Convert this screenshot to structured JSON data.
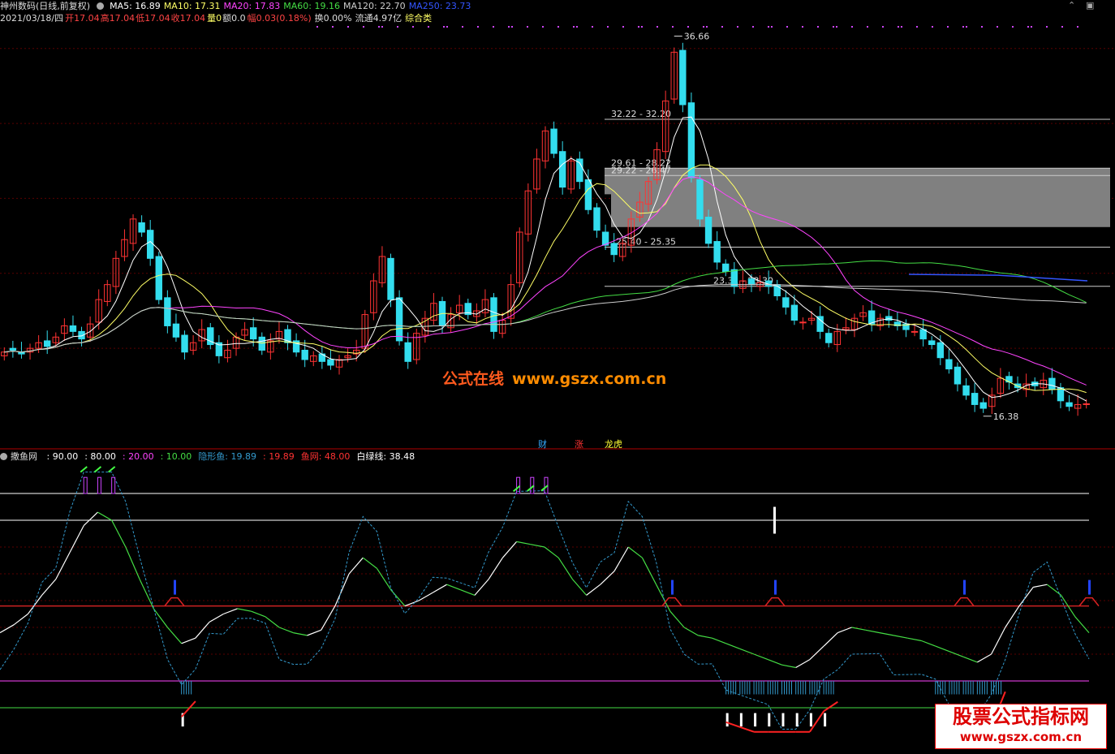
{
  "header": {
    "stock_name": "神州数码(日线,前复权)",
    "ma": [
      {
        "label": "MA5:",
        "value": "16.89",
        "color": "#ffffff"
      },
      {
        "label": "MA10:",
        "value": "17.31",
        "color": "#ffff66"
      },
      {
        "label": "MA20:",
        "value": "17.83",
        "color": "#ff44ff"
      },
      {
        "label": "MA60:",
        "value": "19.16",
        "color": "#44dd44"
      },
      {
        "label": "MA120:",
        "value": "22.70",
        "color": "#cccccc"
      },
      {
        "label": "MA250:",
        "value": "23.73",
        "color": "#3355ff"
      }
    ],
    "date": "2021/03/18/四",
    "open": "开17.04",
    "high": "高17.04",
    "low": "低17.04",
    "close": "收17.04",
    "volume": "量0",
    "amount": "额0.0",
    "range": "幅0.03(0.18%)",
    "turnover": "换0.00%",
    "float_cap": "流通4.97亿",
    "category": "综合类"
  },
  "indicator_header": {
    "name": "撒鱼网",
    "items": [
      {
        "text": ": 90.00",
        "color": "#ffffff"
      },
      {
        "text": ": 80.00",
        "color": "#ffffff"
      },
      {
        "text": ": 20.00",
        "color": "#ff44ff"
      },
      {
        "text": ": 10.00",
        "color": "#44dd44"
      },
      {
        "text": "隐形鱼: 19.89",
        "color": "#3399cc"
      },
      {
        "text": ": 19.89",
        "color": "#ff3333"
      },
      {
        "text": "鱼网: 48.00",
        "color": "#ff3333"
      },
      {
        "text": "白绿线: 38.48",
        "color": "#ffffff"
      }
    ]
  },
  "watermark": {
    "cn": "公式在线",
    "url": "www.gszx.com.cn",
    "logo_title": "股票公式指标网",
    "logo_url": "www.gszx.com.cn"
  },
  "badges": [
    {
      "text": "财",
      "color": "#33aaff"
    },
    {
      "text": "涨",
      "color": "#ff3333"
    },
    {
      "text": "龙虎",
      "color": "#ffff33"
    }
  ],
  "corner_icons": [
    "up-chevron-icon",
    "window-restore-icon"
  ],
  "chart_data": [
    {
      "type": "candlestick",
      "panel": "price",
      "annotations": [
        "36.66",
        "16.38"
      ],
      "high_value": 36.66,
      "low_value": 16.38,
      "price_bands": [
        {
          "label": "32.22 - 32.20",
          "low": 32.2,
          "high": 32.22
        },
        {
          "label": "29.61 - 28.22",
          "low": 28.22,
          "high": 29.61,
          "shaded": true
        },
        {
          "label": "29.22 - 26.47",
          "low": 26.47,
          "high": 29.22,
          "shaded": true
        },
        {
          "label": "25.40 - 25.35",
          "low": 25.35,
          "high": 25.4
        },
        {
          "label": "23.31 - 23.30",
          "low": 23.3,
          "high": 23.31
        }
      ],
      "ylim": [
        15.2,
        37.2
      ],
      "series_colors": {
        "up": "#ff3333",
        "down": "#33ddee"
      },
      "close": [
        19.8,
        19.9,
        19.7,
        20.0,
        20.3,
        20.1,
        20.6,
        21.2,
        20.9,
        20.5,
        21.3,
        22.6,
        23.4,
        24.8,
        25.8,
        26.9,
        26.2,
        24.8,
        22.6,
        21.2,
        20.6,
        19.8,
        20.3,
        21.0,
        20.2,
        19.6,
        19.9,
        20.6,
        21.0,
        20.5,
        19.9,
        20.4,
        20.9,
        20.3,
        19.8,
        19.4,
        19.6,
        19.3,
        19.1,
        19.4,
        19.6,
        19.9,
        21.8,
        23.6,
        24.9,
        22.6,
        20.4,
        19.3,
        20.8,
        21.6,
        22.4,
        21.2,
        21.8,
        22.3,
        21.8,
        22.0,
        22.6,
        20.9,
        21.5,
        23.4,
        26.2,
        28.4,
        30.1,
        31.6,
        30.4,
        28.6,
        30.0,
        28.9,
        27.4,
        26.3,
        25.5,
        25.0,
        25.6,
        26.9,
        27.8,
        28.9,
        30.6,
        33.2,
        35.8,
        33.0,
        29.1,
        26.9,
        25.6,
        24.6,
        24.1,
        23.3,
        23.6,
        23.4,
        23.5,
        23.3,
        22.8,
        22.2,
        21.5,
        21.4,
        21.6,
        20.9,
        20.3,
        20.9,
        21.1,
        21.6,
        21.9,
        21.3,
        21.6,
        21.5,
        21.2,
        21.0,
        20.9,
        20.5,
        20.2,
        19.5,
        18.9,
        18.1,
        17.5,
        17.0,
        16.8,
        17.5,
        18.4,
        18.2,
        17.9,
        18.1,
        18.0,
        18.3,
        17.8,
        17.2,
        16.9,
        17.0,
        17.04
      ],
      "open": [
        19.6,
        20.0,
        19.8,
        19.8,
        20.0,
        20.4,
        20.3,
        20.8,
        21.2,
        20.9,
        20.6,
        21.4,
        22.5,
        23.3,
        24.9,
        25.6,
        26.7,
        26.3,
        24.9,
        22.7,
        21.3,
        20.7,
        19.9,
        20.4,
        21.1,
        20.3,
        19.5,
        20.0,
        20.7,
        21.1,
        20.6,
        19.8,
        20.5,
        21.0,
        20.4,
        19.9,
        19.3,
        19.7,
        19.4,
        19.0,
        19.5,
        19.7,
        20.0,
        21.9,
        23.5,
        24.8,
        22.7,
        20.3,
        19.4,
        20.7,
        21.5,
        22.5,
        21.1,
        21.9,
        22.4,
        21.7,
        21.9,
        22.7,
        20.8,
        21.6,
        23.5,
        26.1,
        28.5,
        30.0,
        31.7,
        30.5,
        28.5,
        30.1,
        29.0,
        27.5,
        26.2,
        25.6,
        24.9,
        25.5,
        27.0,
        27.7,
        29.0,
        30.5,
        33.3,
        35.9,
        33.1,
        29.0,
        27.0,
        25.7,
        24.5,
        24.2,
        23.2,
        23.7,
        23.3,
        23.6,
        23.4,
        22.7,
        22.3,
        21.4,
        21.5,
        21.7,
        20.8,
        20.2,
        21.0,
        21.0,
        21.7,
        22.0,
        21.2,
        21.7,
        21.4,
        21.3,
        20.9,
        21.0,
        20.4,
        20.3,
        19.4,
        19.0,
        18.0,
        17.6,
        17.1,
        16.9,
        17.6,
        18.5,
        18.1,
        17.8,
        18.2,
        17.9,
        18.4,
        17.9,
        17.1,
        16.8,
        17.04
      ]
    },
    {
      "type": "line",
      "panel": "indicator",
      "ylim": [
        0,
        100
      ],
      "reference_lines": [
        90,
        80,
        20,
        10
      ],
      "series": [
        {
          "name": "白绿线",
          "color": "#ffffff",
          "values": [
            38.0,
            41.0,
            45.0,
            52.0,
            58.0,
            68.0,
            78.0,
            83.0,
            80.0,
            70.0,
            58.0,
            47.0,
            40.0,
            34.0,
            36.0,
            42.0,
            45.0,
            47.0,
            46.0,
            44.0,
            40.0,
            38.0,
            37.0,
            39.0,
            48.0,
            60.0,
            66.0,
            62.0,
            54.0,
            48.0,
            50.0,
            53.0,
            56.0,
            54.0,
            52.0,
            58.0,
            66.0,
            72.0,
            71.0,
            70.0,
            66.0,
            58.0,
            52.0,
            56.0,
            61.0,
            70.0,
            66.0,
            56.0,
            46.0,
            40.0,
            37.0,
            36.0,
            34.0,
            32.0,
            30.0,
            28.0,
            26.0,
            25.0,
            28.0,
            33.0,
            38.0,
            40.0,
            39.0,
            38.0,
            37.0,
            36.0,
            35.0,
            33.0,
            31.0,
            29.0,
            27.0,
            30.0,
            40.0,
            48.0,
            55.0,
            56.0,
            52.0,
            44.0,
            38.0
          ]
        }
      ],
      "markers": {
        "fishnet_level": 48.0,
        "hidden_fish": 19.89
      }
    }
  ]
}
